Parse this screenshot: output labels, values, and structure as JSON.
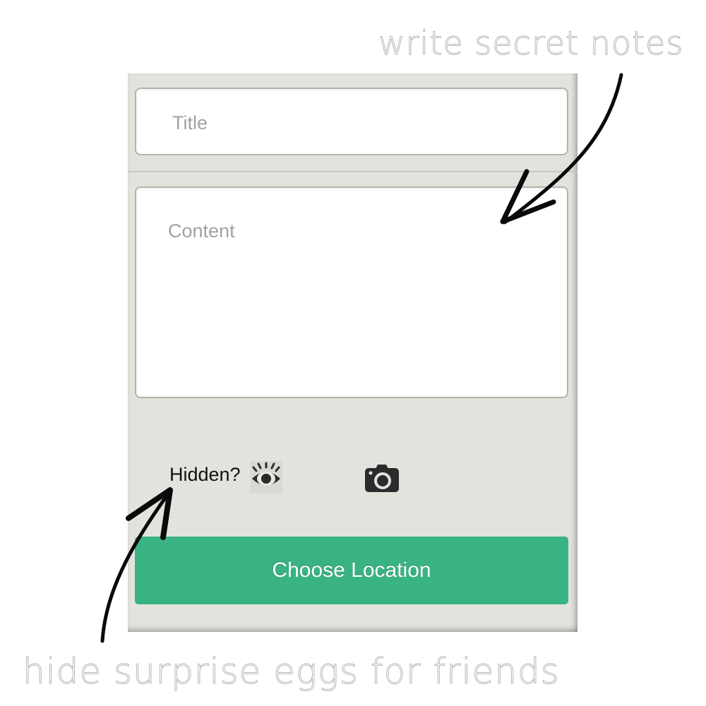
{
  "annotations": {
    "top_caption": "write secret notes",
    "bottom_caption": "hide surprise eggs for friends"
  },
  "form": {
    "title_placeholder": "Title",
    "content_placeholder": "Content",
    "hidden_label": "Hidden?",
    "eye_icon": "eye-icon",
    "camera_icon": "camera-icon",
    "choose_location_label": "Choose Location"
  },
  "colors": {
    "panel_background": "#e3e3de",
    "accent_green": "#3ab382",
    "field_border": "#b3b3ae"
  }
}
